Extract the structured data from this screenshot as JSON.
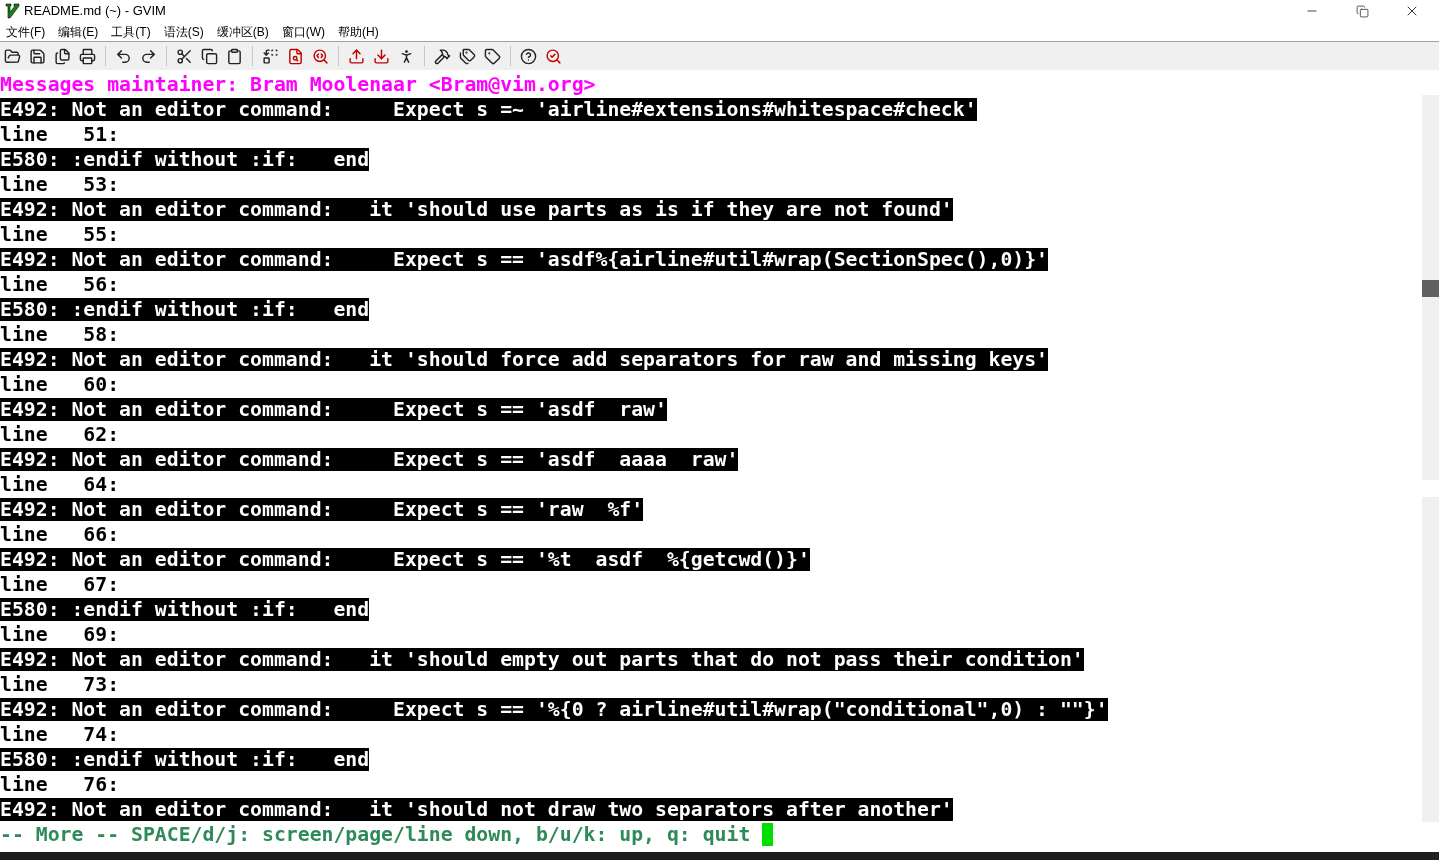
{
  "window": {
    "title": "README.md (~) - GVIM"
  },
  "menu": [
    "文件(F)",
    "编辑(E)",
    "工具(T)",
    "语法(S)",
    "缓冲区(B)",
    "窗口(W)",
    "帮助(H)"
  ],
  "header": "Messages maintainer: Bram Moolenaar <Bram@vim.org>",
  "messages": [
    {
      "kind": "error",
      "text": "E492: Not an editor command:     Expect s =~ 'airline#extensions#whitespace#check'"
    },
    {
      "kind": "line",
      "text": "line   51:"
    },
    {
      "kind": "error",
      "text": "E580: :endif without :if:   end"
    },
    {
      "kind": "line",
      "text": "line   53:"
    },
    {
      "kind": "error",
      "text": "E492: Not an editor command:   it 'should use parts as is if they are not found'"
    },
    {
      "kind": "line",
      "text": "line   55:"
    },
    {
      "kind": "error",
      "text": "E492: Not an editor command:     Expect s == 'asdf%{airline#util#wrap(SectionSpec(),0)}'"
    },
    {
      "kind": "line",
      "text": "line   56:"
    },
    {
      "kind": "error",
      "text": "E580: :endif without :if:   end"
    },
    {
      "kind": "line",
      "text": "line   58:"
    },
    {
      "kind": "error",
      "text": "E492: Not an editor command:   it 'should force add separators for raw and missing keys'"
    },
    {
      "kind": "line",
      "text": "line   60:"
    },
    {
      "kind": "error",
      "text": "E492: Not an editor command:     Expect s == 'asdf  raw'"
    },
    {
      "kind": "line",
      "text": "line   62:"
    },
    {
      "kind": "error",
      "text": "E492: Not an editor command:     Expect s == 'asdf  aaaa  raw'"
    },
    {
      "kind": "line",
      "text": "line   64:"
    },
    {
      "kind": "error",
      "text": "E492: Not an editor command:     Expect s == 'raw  %f'"
    },
    {
      "kind": "line",
      "text": "line   66:"
    },
    {
      "kind": "error",
      "text": "E492: Not an editor command:     Expect s == '%t  asdf  %{getcwd()}'"
    },
    {
      "kind": "line",
      "text": "line   67:"
    },
    {
      "kind": "error",
      "text": "E580: :endif without :if:   end"
    },
    {
      "kind": "line",
      "text": "line   69:"
    },
    {
      "kind": "error",
      "text": "E492: Not an editor command:   it 'should empty out parts that do not pass their condition'"
    },
    {
      "kind": "line",
      "text": "line   73:"
    },
    {
      "kind": "error",
      "text": "E492: Not an editor command:     Expect s == '%{0 ? airline#util#wrap(\"conditional\",0) : \"\"}'"
    },
    {
      "kind": "line",
      "text": "line   74:"
    },
    {
      "kind": "error",
      "text": "E580: :endif without :if:   end"
    },
    {
      "kind": "line",
      "text": "line   76:"
    },
    {
      "kind": "error",
      "text": "E492: Not an editor command:   it 'should not draw two separators after another'"
    }
  ],
  "more_prompt": "-- More -- SPACE/d/j: screen/page/line down, b/u/k: up, q: quit"
}
